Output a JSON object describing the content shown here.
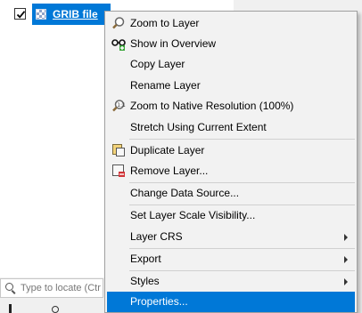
{
  "layer_tree": {
    "layer_name": "GRIB file",
    "checked": true
  },
  "locator": {
    "placeholder": "Type to locate (Ctr"
  },
  "context_menu": {
    "items": [
      {
        "label": "Zoom to Layer",
        "icon": "zoom-layer-icon"
      },
      {
        "label": "Show in Overview",
        "icon": "overview-icon"
      },
      {
        "label": "Copy Layer"
      },
      {
        "label": "Rename Layer"
      },
      {
        "label": "Zoom to Native Resolution (100%)",
        "icon": "native-resolution-icon"
      },
      {
        "label": "Stretch Using Current Extent"
      },
      {
        "label": "Duplicate Layer",
        "icon": "duplicate-layer-icon"
      },
      {
        "label": "Remove Layer...",
        "icon": "remove-layer-icon"
      },
      {
        "label": "Change Data Source..."
      },
      {
        "label": "Set Layer Scale Visibility..."
      },
      {
        "label": "Layer CRS",
        "submenu": true
      },
      {
        "label": "Export",
        "submenu": true
      },
      {
        "label": "Styles",
        "submenu": true
      },
      {
        "label": "Properties...",
        "highlighted": true
      }
    ]
  },
  "colors": {
    "selection": "#0078d7",
    "menu_bg": "#f2f2f2"
  }
}
